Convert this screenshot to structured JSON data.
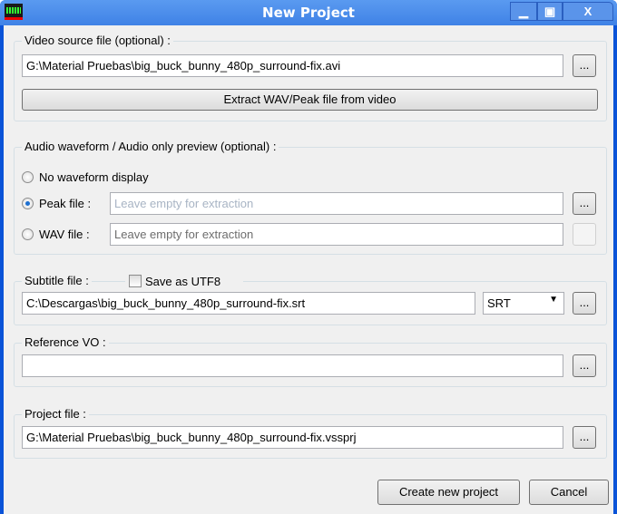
{
  "window": {
    "title": "New Project",
    "minimize": "▁",
    "maximize": "▣",
    "close": "X"
  },
  "video": {
    "label": "Video source file (optional) :",
    "value": "G:\\Material Pruebas\\big_buck_bunny_480p_surround-fix.avi",
    "browse": "...",
    "extract": "Extract WAV/Peak file from video"
  },
  "audio": {
    "label": "Audio waveform / Audio only preview (optional) :",
    "none": "No waveform display",
    "peak": "Peak file :",
    "peak_placeholder": "Leave empty for extraction",
    "wav": "WAV file :",
    "wav_placeholder": "Leave empty for extraction",
    "browse": "...",
    "selected": "peak"
  },
  "subtitle": {
    "label": "Subtitle file :",
    "utf8": "Save as UTF8",
    "value": "C:\\Descargas\\big_buck_bunny_480p_surround-fix.srt",
    "format": "SRT",
    "browse": "..."
  },
  "reference": {
    "label": "Reference VO :",
    "value": "",
    "browse": "..."
  },
  "project": {
    "label": "Project file :",
    "value": "G:\\Material Pruebas\\big_buck_bunny_480p_surround-fix.vssprj",
    "browse": "..."
  },
  "buttons": {
    "create": "Create new project",
    "cancel": "Cancel"
  }
}
